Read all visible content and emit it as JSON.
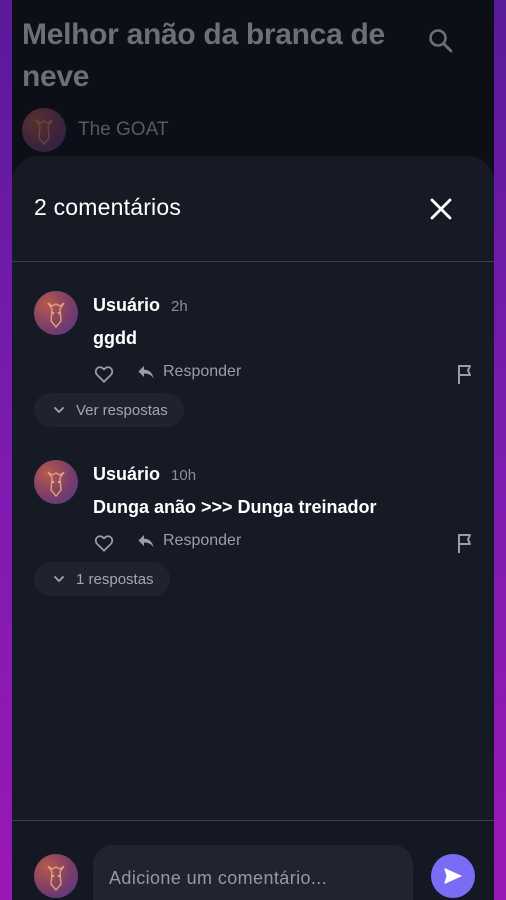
{
  "post": {
    "title": "Melhor anão da branca de neve",
    "author": "The GOAT"
  },
  "sheet": {
    "title": "2 comentários"
  },
  "comments": [
    {
      "user": "Usuário",
      "time": "2h",
      "text": "ggdd",
      "reply_label": "Responder",
      "replies_label": "Ver respostas"
    },
    {
      "user": "Usuário",
      "time": "10h",
      "text": "Dunga anão >>> Dunga treinador",
      "reply_label": "Responder",
      "replies_label": "1 respostas"
    }
  ],
  "composer": {
    "placeholder": "Adicione um comentário..."
  },
  "colors": {
    "accent": "#7b6cf6",
    "sheet_bg": "#151a24",
    "backdrop_edge": "#8a1ab0"
  },
  "icons": [
    "search-icon",
    "close-icon",
    "heart-icon",
    "reply-icon",
    "flag-icon",
    "chevron-down-icon",
    "send-icon"
  ]
}
